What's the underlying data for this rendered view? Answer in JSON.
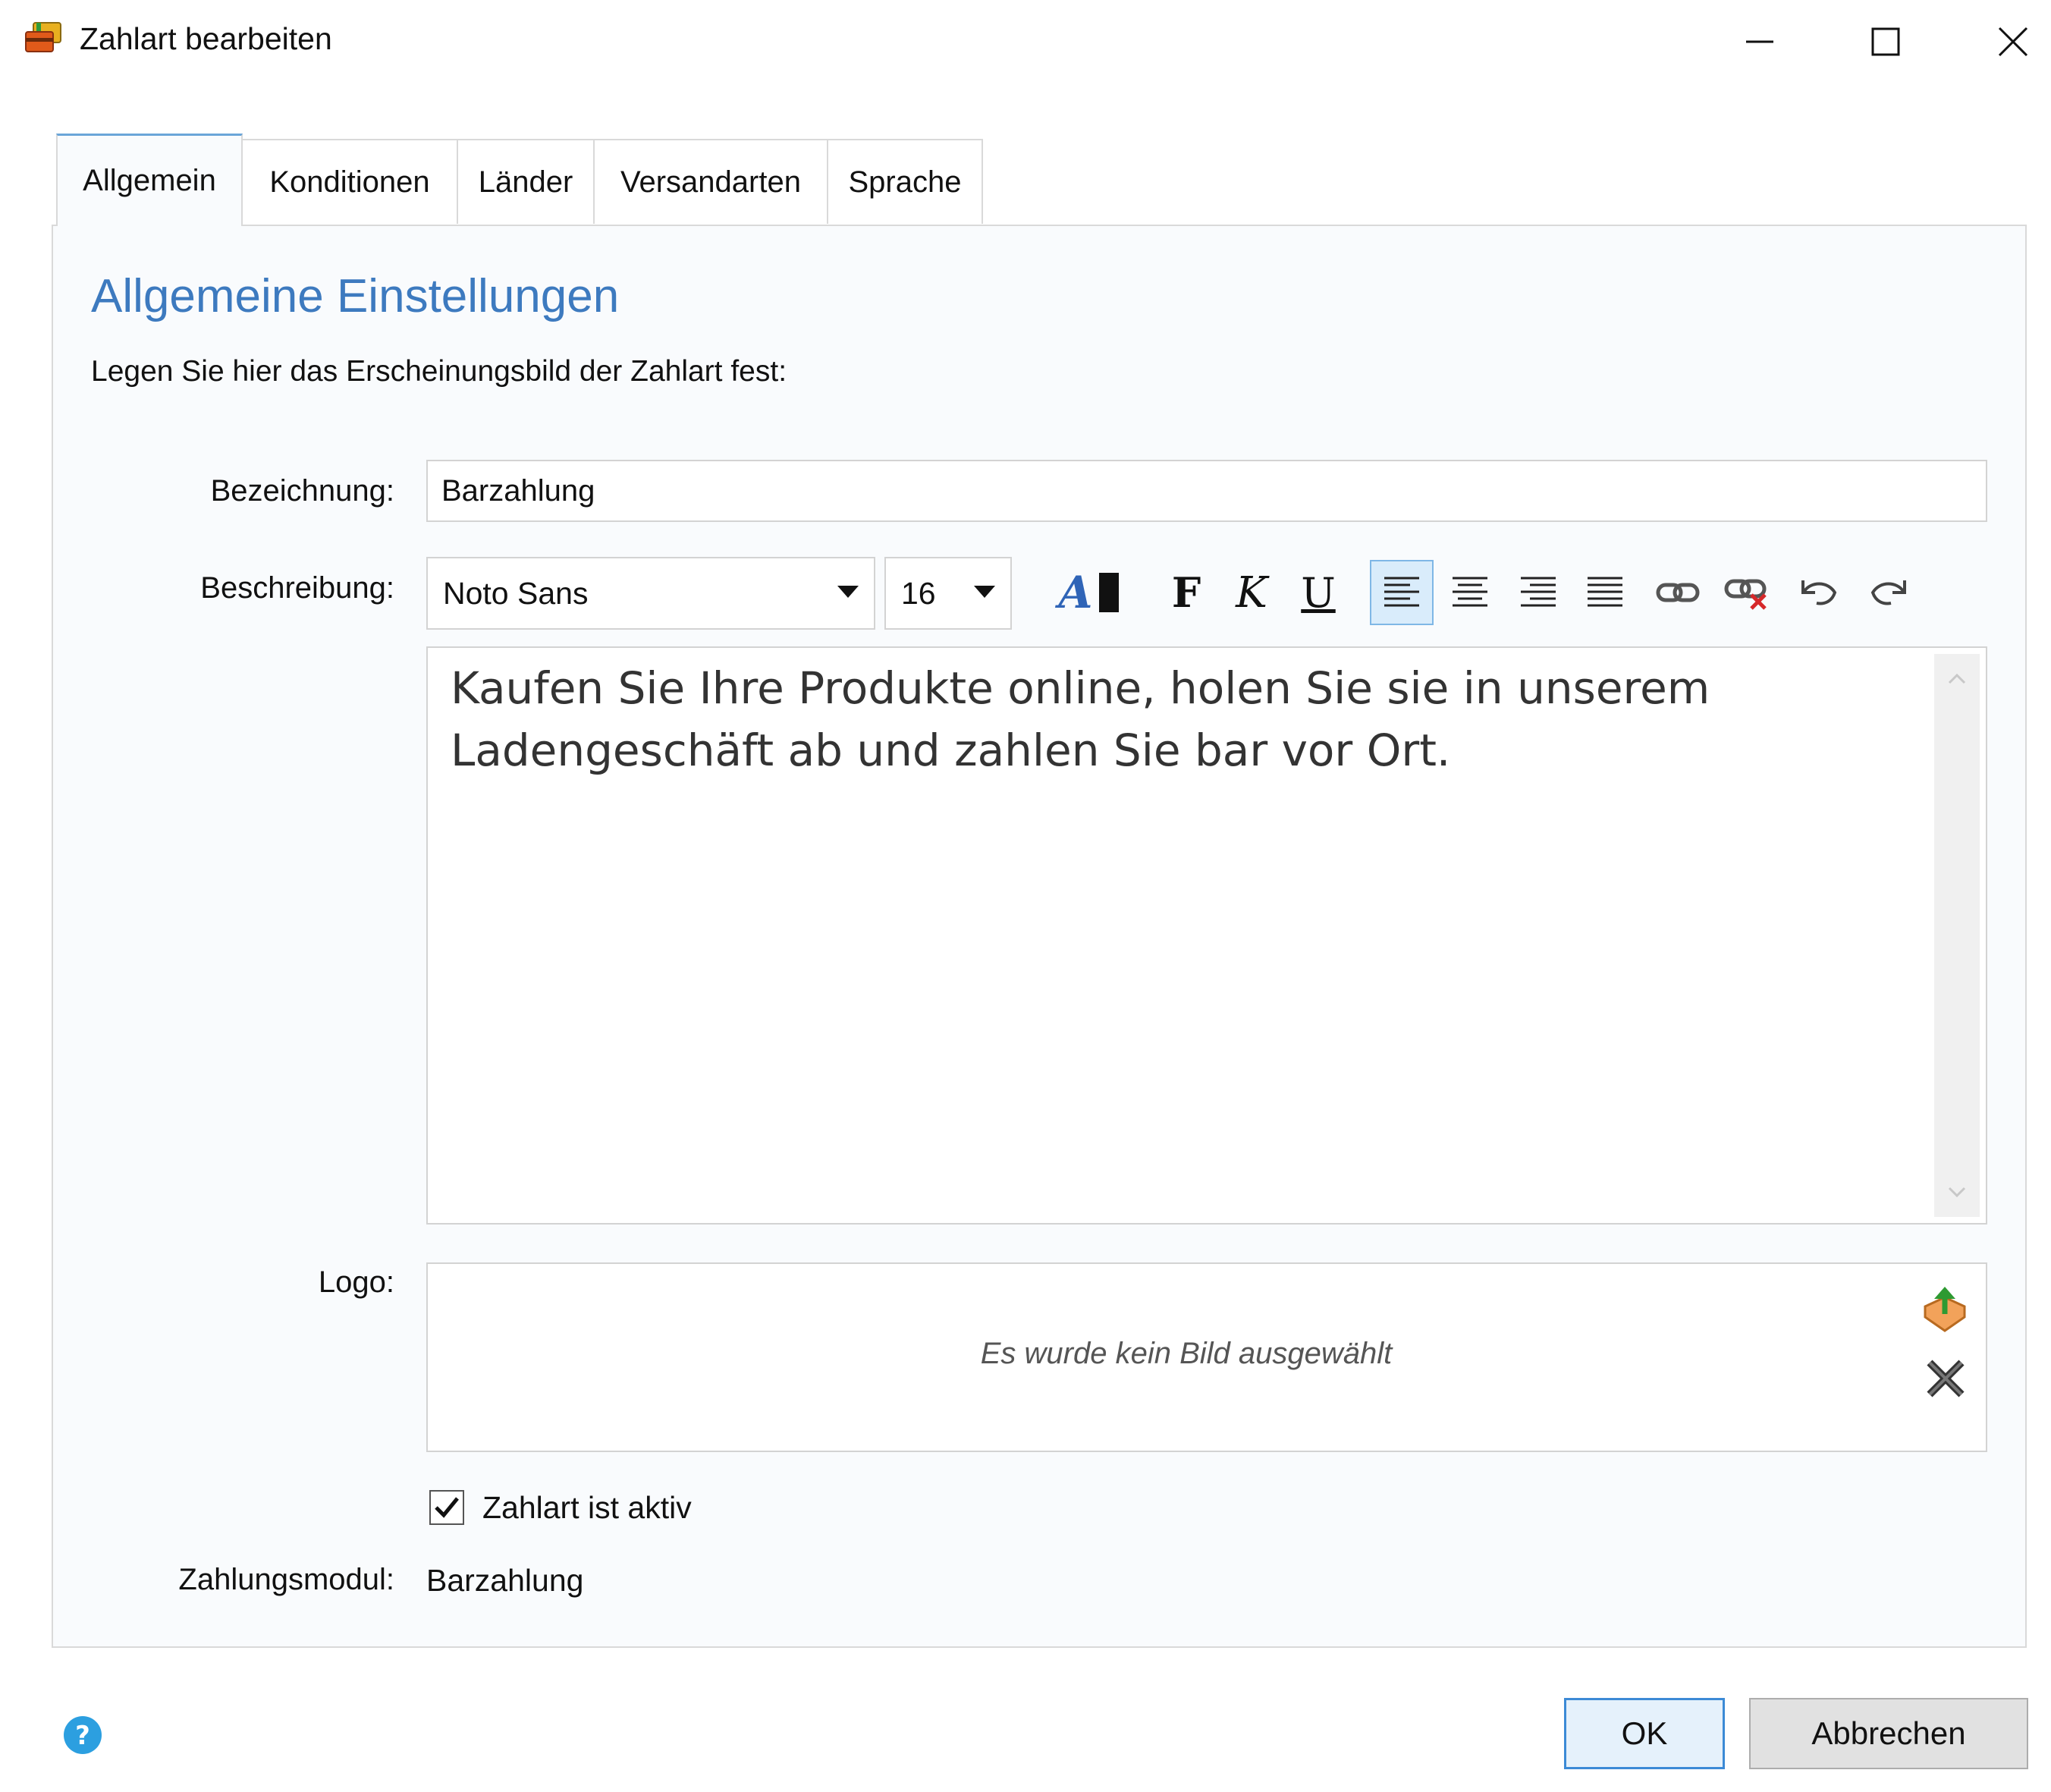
{
  "window": {
    "title": "Zahlart bearbeiten",
    "icon": "payment-cards-icon",
    "controls": [
      "minimize-icon",
      "maximize-icon",
      "close-icon"
    ]
  },
  "tabs": [
    {
      "label": "Allgemein",
      "active": true
    },
    {
      "label": "Konditionen",
      "active": false
    },
    {
      "label": "Länder",
      "active": false
    },
    {
      "label": "Versandarten",
      "active": false
    },
    {
      "label": "Sprache",
      "active": false
    }
  ],
  "general": {
    "heading": "Allgemeine Einstellungen",
    "subtitle": "Legen Sie hier das Erscheinungsbild der Zahlart fest:",
    "name_label": "Bezeichnung:",
    "name_value": "Barzahlung",
    "description_label": "Beschreibung:",
    "font_value": "Noto Sans",
    "size_value": "16",
    "toolbar": {
      "bold": "F",
      "italic": "K",
      "underline": "U",
      "color_letter": "A",
      "selected_alignment": "left",
      "icons": [
        "text-color-icon",
        "bold-icon",
        "italic-icon",
        "underline-icon",
        "align-left-icon",
        "align-center-icon",
        "align-right-icon",
        "align-justify-icon",
        "link-icon",
        "unlink-icon",
        "undo-icon",
        "redo-icon"
      ]
    },
    "description_text": "Kaufen Sie Ihre Produkte online, holen Sie sie in unserem Ladengeschäft ab und zahlen Sie bar vor Ort.",
    "logo_label": "Logo:",
    "logo_placeholder": "Es wurde kein Bild ausgewählt",
    "active_label": "Zahlart ist aktiv",
    "active_checked": true,
    "module_label": "Zahlungsmodul:",
    "module_value": "Barzahlung"
  },
  "footer": {
    "ok": "OK",
    "cancel": "Abbrechen",
    "help_icon": "help-icon"
  },
  "colors": {
    "accent": "#3d7abf",
    "tab_active_border": "#6aa5d8",
    "primary_button_border": "#3c8ad6"
  }
}
